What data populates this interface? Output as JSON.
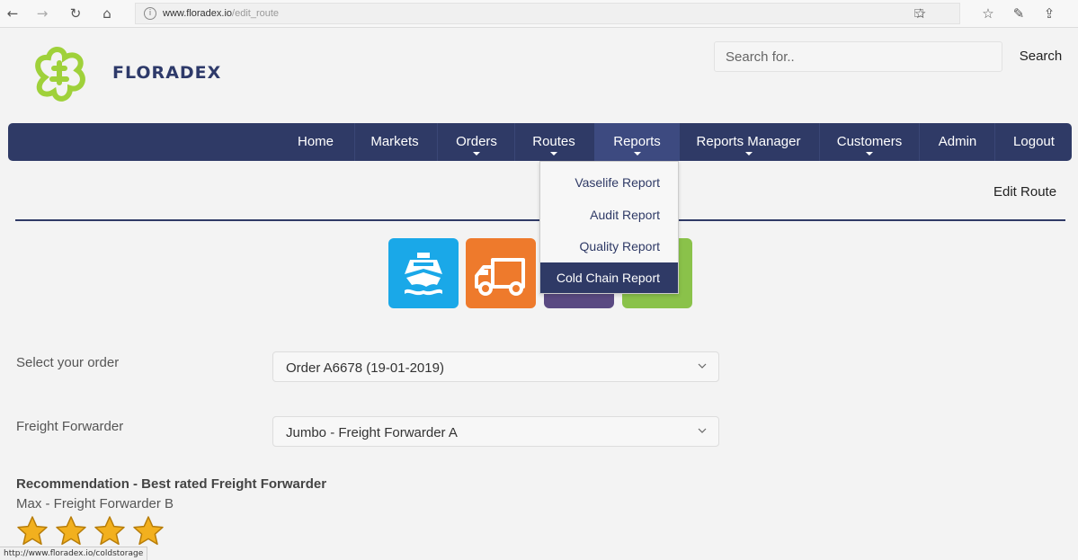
{
  "browser": {
    "url_domain": "www.floradex.io",
    "url_path": "/edit_route"
  },
  "header": {
    "brand": "FLORADEX",
    "search_placeholder": "Search for..",
    "search_label": "Search"
  },
  "nav": {
    "items": [
      {
        "label": "Home"
      },
      {
        "label": "Markets"
      },
      {
        "label": "Orders"
      },
      {
        "label": "Routes"
      },
      {
        "label": "Reports"
      },
      {
        "label": "Reports Manager"
      },
      {
        "label": "Customers"
      },
      {
        "label": "Admin"
      },
      {
        "label": "Logout"
      }
    ],
    "active": "Reports"
  },
  "reports_menu": {
    "items": [
      {
        "label": "Vaselife Report"
      },
      {
        "label": "Audit Report"
      },
      {
        "label": "Quality Report"
      },
      {
        "label": "Cold Chain Report"
      }
    ],
    "highlighted": "Cold Chain Report"
  },
  "page": {
    "heading": "Edit Route"
  },
  "transport_modes": [
    "ship",
    "truck",
    "plane",
    "train"
  ],
  "form": {
    "order_label": "Select your order",
    "order_value": "Order A6678 (19-01-2019)",
    "forwarder_label": "Freight Forwarder",
    "forwarder_value": "Jumbo - Freight Forwarder A"
  },
  "recommendation": {
    "title": "Recommendation - Best rated Freight Forwarder",
    "name": "Max - Freight Forwarder B",
    "rating": 4
  },
  "status_bar": {
    "link": "http://www.floradex.io/coldstorage"
  },
  "colors": {
    "navbar": "#2f3a66",
    "ship": "#1aa8e8",
    "truck": "#ee7a2c",
    "plane": "#5a4a82",
    "train": "#8ac24a",
    "logo": "#9fd13a"
  }
}
